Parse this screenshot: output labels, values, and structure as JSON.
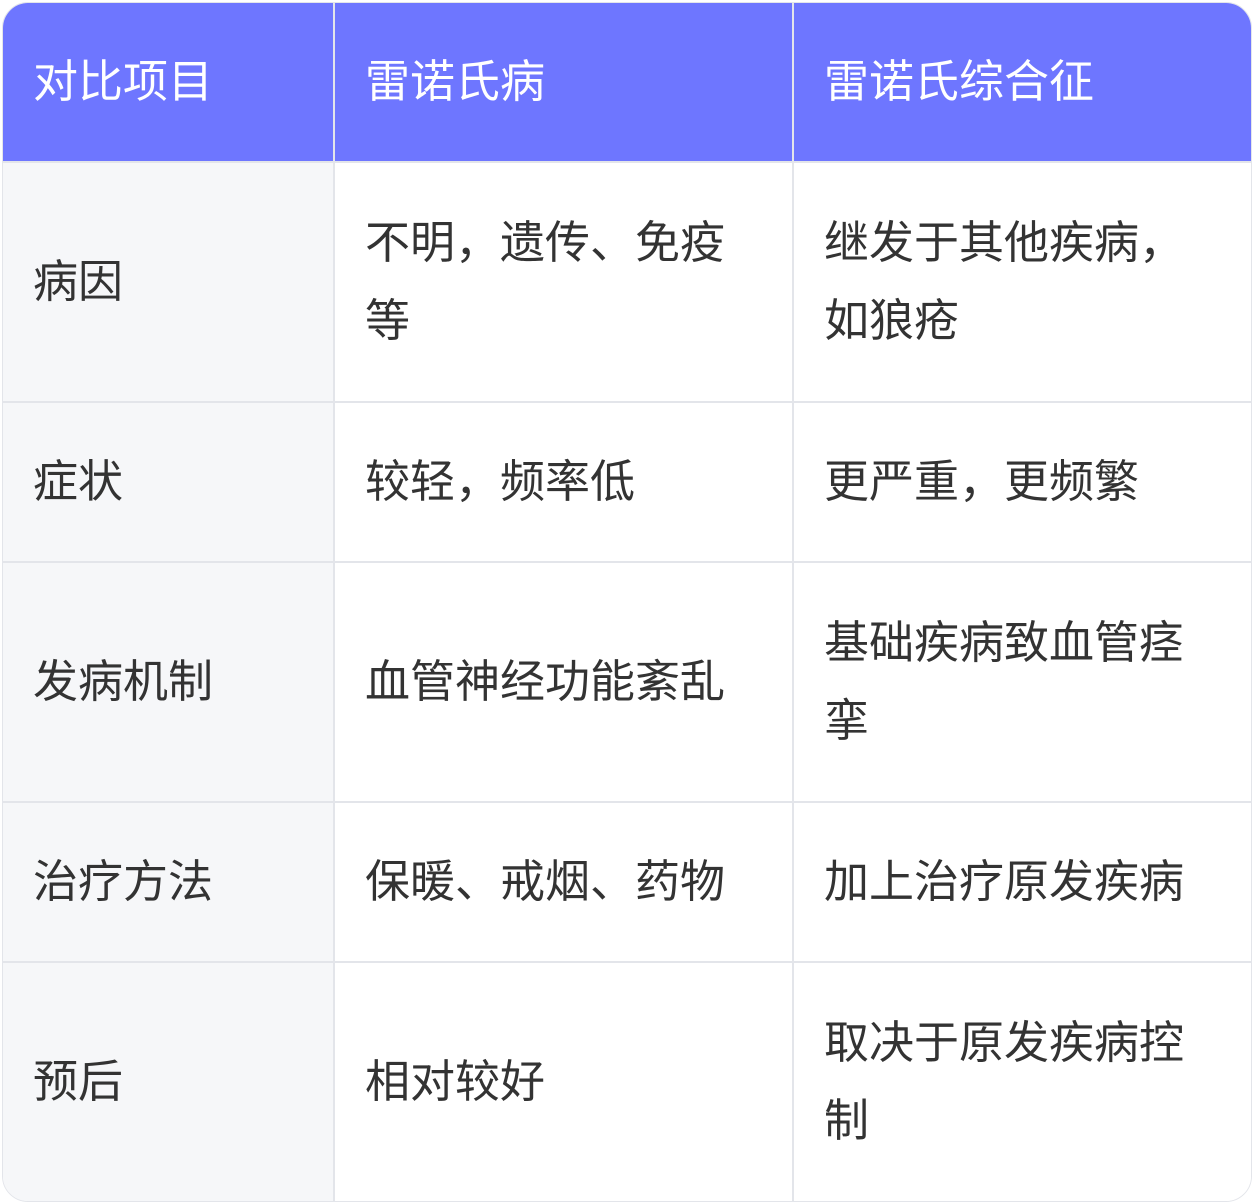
{
  "header": {
    "col1": "对比项目",
    "col2": "雷诺氏病",
    "col3": "雷诺氏综合征"
  },
  "rows": [
    {
      "label": "病因",
      "disease": "不明，遗传、免疫等",
      "syndrome": "继发于其他疾病，如狼疮"
    },
    {
      "label": "症状",
      "disease": "较轻，频率低",
      "syndrome": "更严重，更频繁"
    },
    {
      "label": "发病机制",
      "disease": "血管神经功能紊乱",
      "syndrome": "基础疾病致血管痉挛"
    },
    {
      "label": "治疗方法",
      "disease": "保暖、戒烟、药物",
      "syndrome": "加上治疗原发疾病"
    },
    {
      "label": "预后",
      "disease": "相对较好",
      "syndrome": "取决于原发疾病控制"
    }
  ],
  "colors": {
    "header_bg": "#6e76ff",
    "header_text": "#ffffff",
    "label_bg": "#f6f7f9",
    "border": "#e3e5ea",
    "text": "#333333"
  }
}
